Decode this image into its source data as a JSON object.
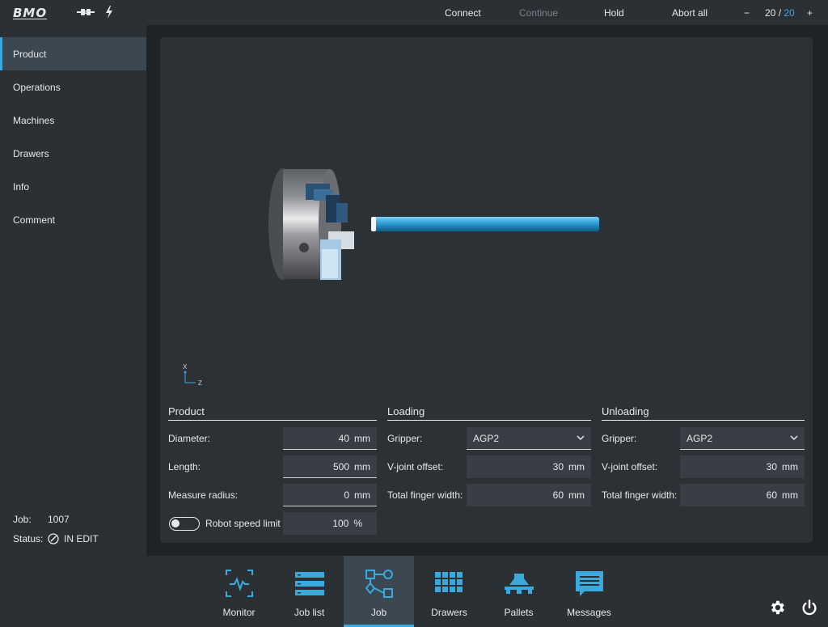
{
  "topbar": {
    "logo": "BMO",
    "connect": "Connect",
    "continue": "Continue",
    "hold": "Hold",
    "abort": "Abort all",
    "counter_minus": "−",
    "counter_current": "20",
    "counter_sep": " / ",
    "counter_max": "20",
    "counter_plus": "+"
  },
  "sidebar": {
    "items": [
      {
        "label": "Product",
        "active": true
      },
      {
        "label": "Operations"
      },
      {
        "label": "Machines"
      },
      {
        "label": "Drawers"
      },
      {
        "label": "Info"
      },
      {
        "label": "Comment"
      }
    ],
    "job_label": "Job:",
    "job_value": "1007",
    "status_label": "Status:",
    "status_value": "IN EDIT"
  },
  "viewport": {
    "axis_x": "X",
    "axis_z": "Z"
  },
  "product": {
    "title": "Product",
    "diameter_label": "Diameter:",
    "diameter_value": "40",
    "diameter_unit": "mm",
    "length_label": "Length:",
    "length_value": "500",
    "length_unit": "mm",
    "measure_radius_label": "Measure radius:",
    "measure_radius_value": "0",
    "measure_radius_unit": "mm",
    "speed_limit_label": "Robot speed limit",
    "speed_limit_value": "100",
    "speed_limit_unit": "%"
  },
  "loading": {
    "title": "Loading",
    "gripper_label": "Gripper:",
    "gripper_value": "AGP2",
    "vjoint_label": "V-joint offset:",
    "vjoint_value": "30",
    "vjoint_unit": "mm",
    "finger_label": "Total finger width:",
    "finger_value": "60",
    "finger_unit": "mm"
  },
  "unloading": {
    "title": "Unloading",
    "gripper_label": "Gripper:",
    "gripper_value": "AGP2",
    "vjoint_label": "V-joint offset:",
    "vjoint_value": "30",
    "vjoint_unit": "mm",
    "finger_label": "Total finger width:",
    "finger_value": "60",
    "finger_unit": "mm"
  },
  "bottomnav": [
    {
      "label": "Monitor",
      "icon": "monitor-icon"
    },
    {
      "label": "Job list",
      "icon": "job-list-icon"
    },
    {
      "label": "Job",
      "icon": "job-icon",
      "active": true
    },
    {
      "label": "Drawers",
      "icon": "drawers-icon"
    },
    {
      "label": "Pallets",
      "icon": "pallets-icon"
    },
    {
      "label": "Messages",
      "icon": "messages-icon"
    }
  ],
  "colors": {
    "accent": "#3aa9dc",
    "background": "#1f2326",
    "panel": "#2c3136",
    "field": "#383e44"
  }
}
